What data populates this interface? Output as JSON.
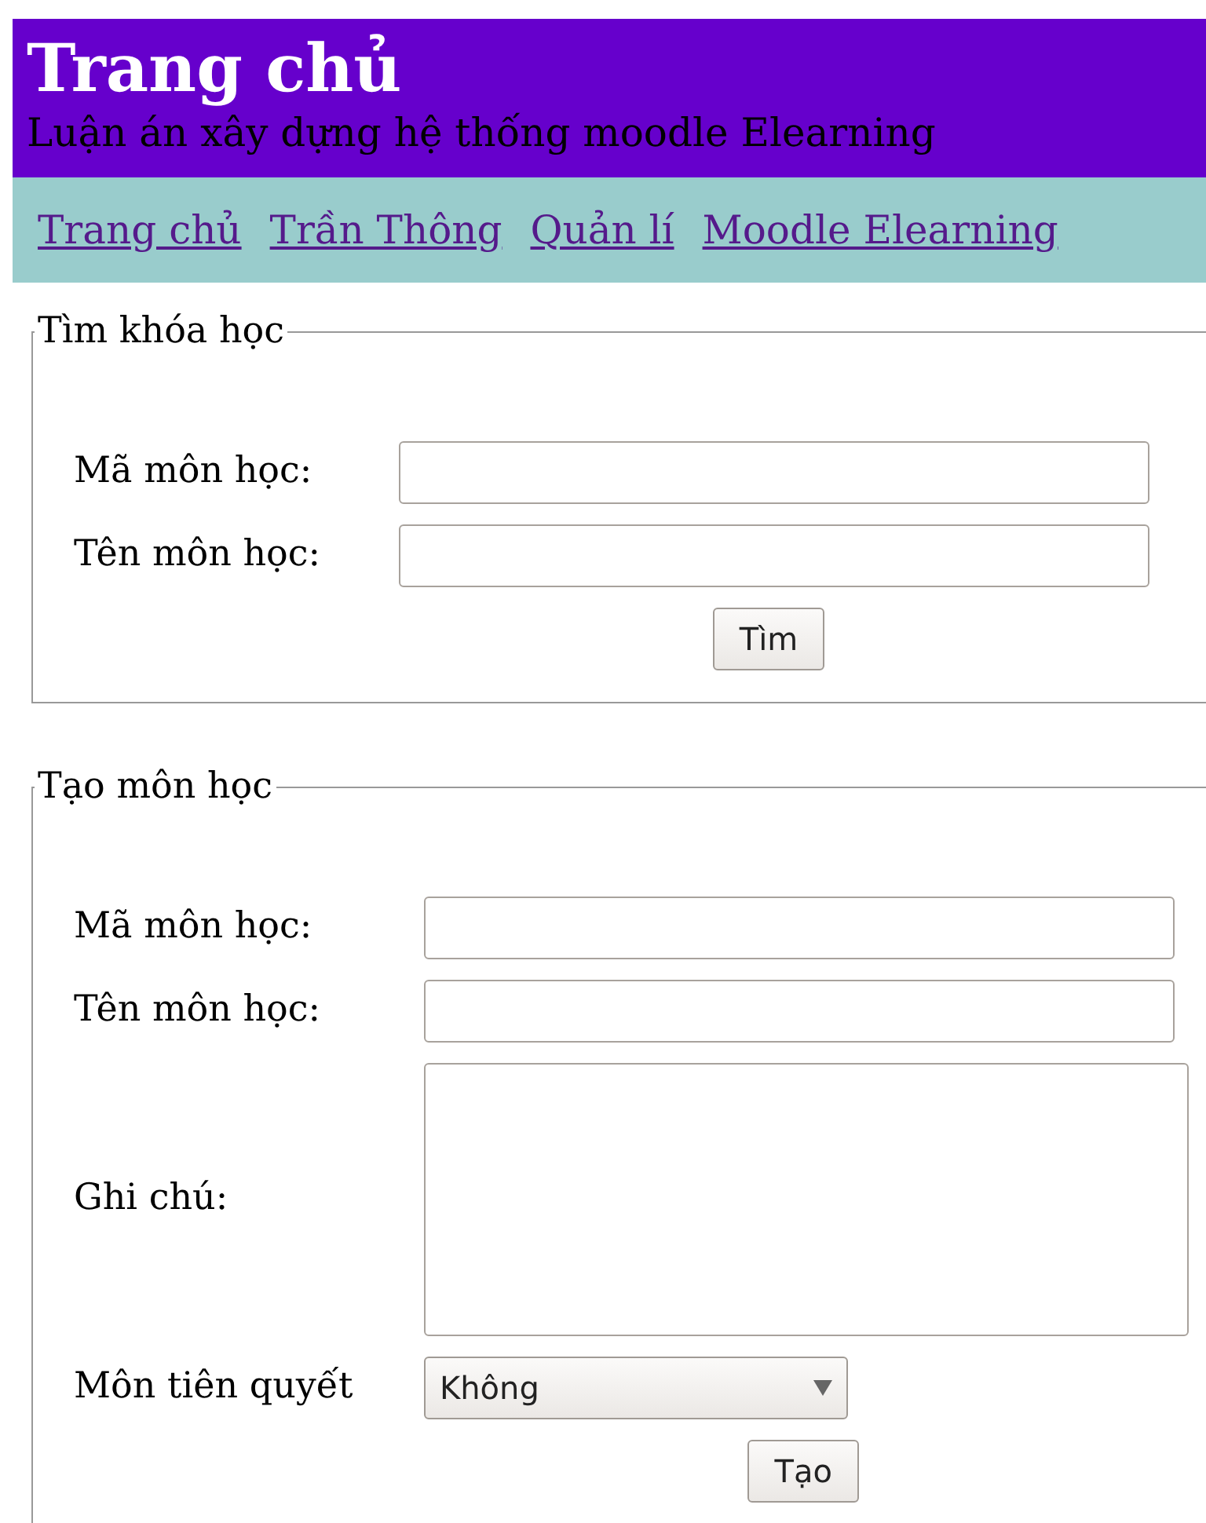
{
  "header": {
    "title": "Trang chủ",
    "subtitle": "Luận án xây dựng hệ thống moodle Elearning"
  },
  "nav": [
    "Trang chủ",
    "Trần Thông",
    "Quản lí",
    "Moodle Elearning"
  ],
  "search_form": {
    "legend": "Tìm khóa học",
    "fields": [
      {
        "label": "Mã môn học:"
      },
      {
        "label": "Tên môn học:"
      }
    ],
    "button": "Tìm"
  },
  "create_form": {
    "legend": "Tạo môn học",
    "fields": [
      {
        "kind": "input",
        "label": "Mã môn học:"
      },
      {
        "kind": "input",
        "label": "Tên môn học:"
      },
      {
        "kind": "textarea",
        "label": "Ghi chú:"
      },
      {
        "kind": "select",
        "label": "Môn tiên quyết",
        "value": "Không"
      }
    ],
    "button": "Tạo"
  }
}
